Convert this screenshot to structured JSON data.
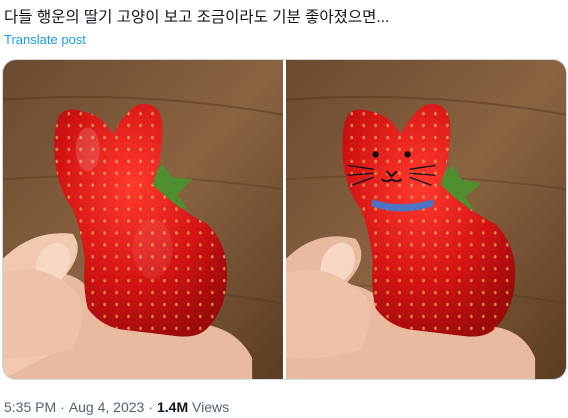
{
  "tweet": {
    "text": "다들 행운의 딸기 고양이 보고 조금이라도 기분 좋아졌으면...",
    "translate_label": "Translate post"
  },
  "media": {
    "photos": [
      {
        "subject": "cat-shaped strawberry held in hand"
      },
      {
        "subject": "cat-shaped strawberry with drawn face and blue collar"
      }
    ]
  },
  "meta": {
    "time": "5:35 PM",
    "date": "Aug 4, 2023",
    "separator": "·",
    "views_count": "1.4M",
    "views_label": "Views"
  },
  "colors": {
    "link": "#1d9bf0",
    "text": "#0f1419",
    "muted": "#536471",
    "strawberry": "#d8191a",
    "collar": "#3a7bd5"
  }
}
